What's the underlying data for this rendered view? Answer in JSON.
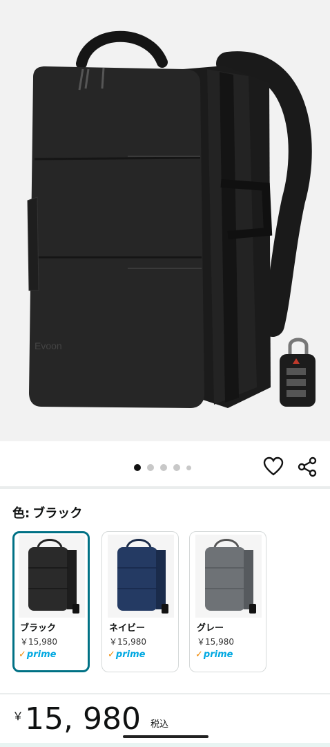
{
  "hero": {
    "brand_text": "Evoon",
    "image_count": 5,
    "active_image": 1
  },
  "actions": {
    "favorite_icon": "heart-icon",
    "share_icon": "share-icon"
  },
  "variation": {
    "label": "色:",
    "selected": "ブラック",
    "options": [
      {
        "name": "ブラック",
        "price": "￥15,980",
        "prime": "prime",
        "color": "#2a2a2a",
        "selected": true
      },
      {
        "name": "ネイビー",
        "price": "￥15,980",
        "prime": "prime",
        "color": "#243a63",
        "selected": false
      },
      {
        "name": "グレー",
        "price": "￥15,980",
        "prime": "prime",
        "color": "#6e7276",
        "selected": false
      }
    ]
  },
  "price": {
    "yen": "￥",
    "amount": "15, 980",
    "tax": "税込"
  },
  "colors": {
    "selected_border": "#007185",
    "prime_blue": "#00a8e1",
    "prime_check": "#f08804"
  }
}
